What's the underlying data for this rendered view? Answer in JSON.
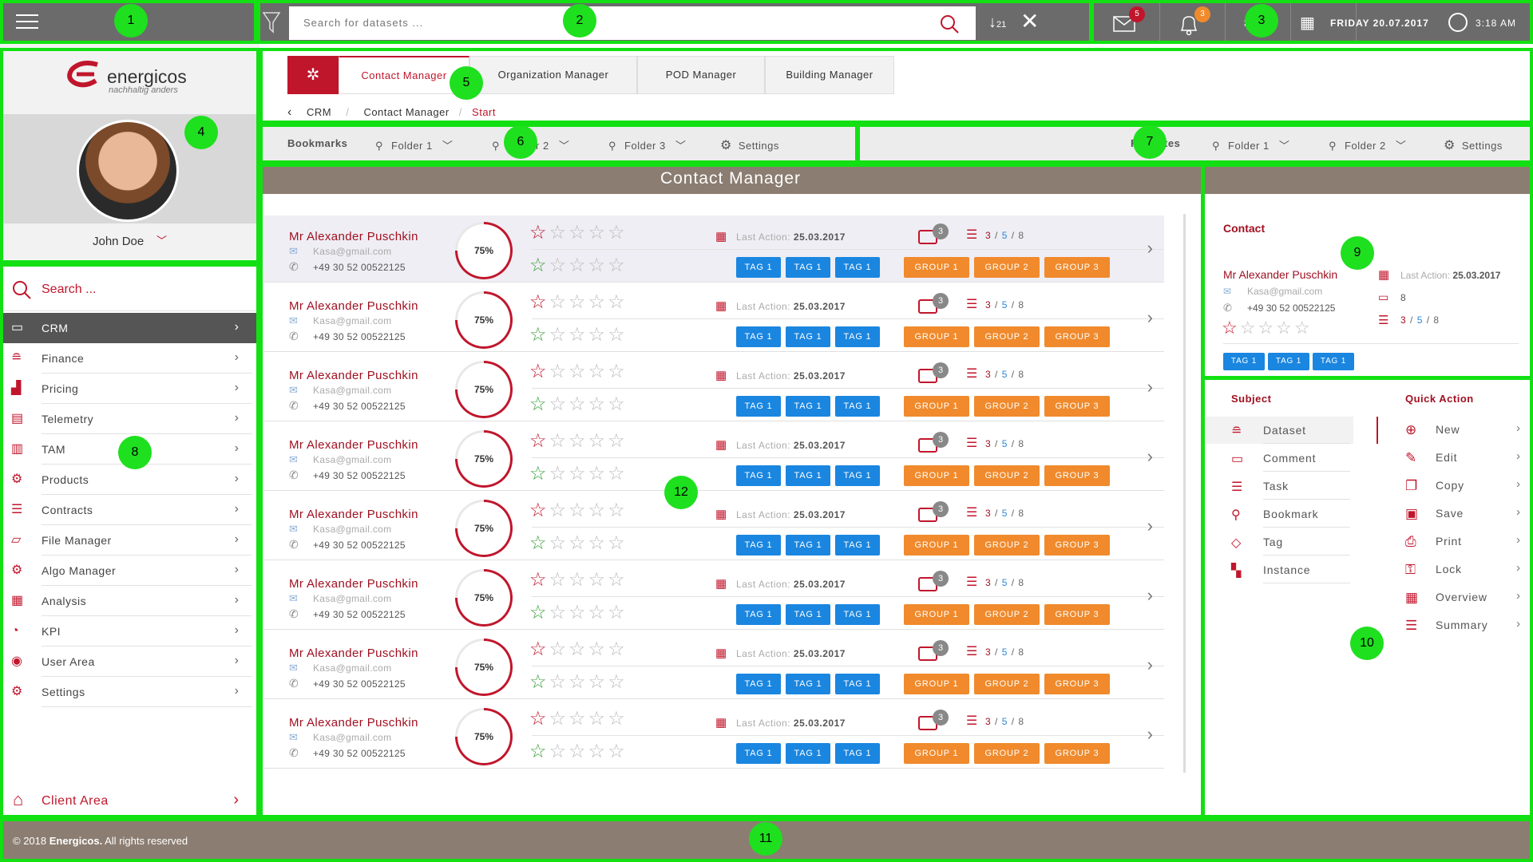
{
  "topbar": {
    "search_placeholder": "Search for datasets ...",
    "mail_count": "5",
    "notif_count": "3",
    "date": "FRIDAY 20.07.2017",
    "time": "3:18 AM"
  },
  "profile": {
    "brand": "energicos",
    "brand_tagline": "nachhaltig anders",
    "username": "John Doe"
  },
  "sidebar": {
    "search_placeholder": "Search ...",
    "items": [
      {
        "label": "CRM",
        "icon": "monitor-icon",
        "active": true
      },
      {
        "label": "Finance",
        "icon": "coins-icon"
      },
      {
        "label": "Pricing",
        "icon": "pricing-chart-icon"
      },
      {
        "label": "Telemetry",
        "icon": "telemetry-icon"
      },
      {
        "label": "TAM",
        "icon": "battery-icon"
      },
      {
        "label": "Products",
        "icon": "products-icon"
      },
      {
        "label": "Contracts",
        "icon": "contracts-icon"
      },
      {
        "label": "File Manager",
        "icon": "folder-icon"
      },
      {
        "label": "Algo Manager",
        "icon": "algo-icon"
      },
      {
        "label": "Analysis",
        "icon": "analysis-icon"
      },
      {
        "label": "KPI",
        "icon": "kpi-icon"
      },
      {
        "label": "User Area",
        "icon": "eye-icon"
      },
      {
        "label": "Settings",
        "icon": "gear-icon"
      }
    ],
    "client_area": "Client Area"
  },
  "tabs": [
    {
      "label": "Contact Manager",
      "active": true
    },
    {
      "label": "Organization Manager"
    },
    {
      "label": "POD Manager"
    },
    {
      "label": "Building Manager"
    }
  ],
  "breadcrumb": {
    "items": [
      "CRM",
      "Contact Manager"
    ],
    "current": "Start"
  },
  "bookmarks": {
    "title": "Bookmarks",
    "folders": [
      "Folder 1",
      "Folder 2",
      "Folder 3"
    ],
    "settings": "Settings"
  },
  "favorites": {
    "title": "Favorites",
    "folders": [
      "Folder 1",
      "Folder 2"
    ],
    "settings": "Settings"
  },
  "main": {
    "title": "Contact Manager",
    "rows": [
      {
        "name": "Mr Alexander Puschkin",
        "email": "Kasa@gmail.com",
        "phone": "+49 30 52 00522125",
        "progress": "75%",
        "last_action_label": "Last Action:",
        "last_action": "25.03.2017",
        "comments": "3",
        "tasks_done": "3",
        "tasks_open": "5",
        "tasks_total": "8",
        "tags": [
          "TAG 1",
          "TAG 1",
          "TAG 1"
        ],
        "groups": [
          "GROUP 1",
          "GROUP 2",
          "GROUP 3"
        ]
      },
      {
        "name": "Mr Alexander Puschkin",
        "email": "Kasa@gmail.com",
        "phone": "+49 30 52 00522125",
        "progress": "75%",
        "last_action_label": "Last Action:",
        "last_action": "25.03.2017",
        "comments": "3",
        "tasks_done": "3",
        "tasks_open": "5",
        "tasks_total": "8",
        "tags": [
          "TAG 1",
          "TAG 1",
          "TAG 1"
        ],
        "groups": [
          "GROUP 1",
          "GROUP 2",
          "GROUP 3"
        ]
      },
      {
        "name": "Mr Alexander Puschkin",
        "email": "Kasa@gmail.com",
        "phone": "+49 30 52 00522125",
        "progress": "75%",
        "last_action_label": "Last Action:",
        "last_action": "25.03.2017",
        "comments": "3",
        "tasks_done": "3",
        "tasks_open": "5",
        "tasks_total": "8",
        "tags": [
          "TAG 1",
          "TAG 1",
          "TAG 1"
        ],
        "groups": [
          "GROUP 1",
          "GROUP 2",
          "GROUP 3"
        ]
      },
      {
        "name": "Mr Alexander Puschkin",
        "email": "Kasa@gmail.com",
        "phone": "+49 30 52 00522125",
        "progress": "75%",
        "last_action_label": "Last Action:",
        "last_action": "25.03.2017",
        "comments": "3",
        "tasks_done": "3",
        "tasks_open": "5",
        "tasks_total": "8",
        "tags": [
          "TAG 1",
          "TAG 1",
          "TAG 1"
        ],
        "groups": [
          "GROUP 1",
          "GROUP 2",
          "GROUP 3"
        ]
      },
      {
        "name": "Mr Alexander Puschkin",
        "email": "Kasa@gmail.com",
        "phone": "+49 30 52 00522125",
        "progress": "75%",
        "last_action_label": "Last Action:",
        "last_action": "25.03.2017",
        "comments": "3",
        "tasks_done": "3",
        "tasks_open": "5",
        "tasks_total": "8",
        "tags": [
          "TAG 1",
          "TAG 1",
          "TAG 1"
        ],
        "groups": [
          "GROUP 1",
          "GROUP 2",
          "GROUP 3"
        ]
      },
      {
        "name": "Mr Alexander Puschkin",
        "email": "Kasa@gmail.com",
        "phone": "+49 30 52 00522125",
        "progress": "75%",
        "last_action_label": "Last Action:",
        "last_action": "25.03.2017",
        "comments": "3",
        "tasks_done": "3",
        "tasks_open": "5",
        "tasks_total": "8",
        "tags": [
          "TAG 1",
          "TAG 1",
          "TAG 1"
        ],
        "groups": [
          "GROUP 1",
          "GROUP 2",
          "GROUP 3"
        ]
      },
      {
        "name": "Mr Alexander Puschkin",
        "email": "Kasa@gmail.com",
        "phone": "+49 30 52 00522125",
        "progress": "75%",
        "last_action_label": "Last Action:",
        "last_action": "25.03.2017",
        "comments": "3",
        "tasks_done": "3",
        "tasks_open": "5",
        "tasks_total": "8",
        "tags": [
          "TAG 1",
          "TAG 1",
          "TAG 1"
        ],
        "groups": [
          "GROUP 1",
          "GROUP 2",
          "GROUP 3"
        ]
      },
      {
        "name": "Mr Alexander Puschkin",
        "email": "Kasa@gmail.com",
        "phone": "+49 30 52 00522125",
        "progress": "75%",
        "last_action_label": "Last Action:",
        "last_action": "25.03.2017",
        "comments": "3",
        "tasks_done": "3",
        "tasks_open": "5",
        "tasks_total": "8",
        "tags": [
          "TAG 1",
          "TAG 1",
          "TAG 1"
        ],
        "groups": [
          "GROUP 1",
          "GROUP 2",
          "GROUP 3"
        ]
      }
    ]
  },
  "contact_card": {
    "title": "Contact",
    "name": "Mr Alexander Puschkin",
    "email": "Kasa@gmail.com",
    "phone": "+49 30 52 00522125",
    "last_action_label": "Last Action:",
    "last_action": "25.03.2017",
    "comments": "8",
    "tasks_done": "3",
    "tasks_open": "5",
    "tasks_total": "8",
    "tags": [
      "TAG 1",
      "TAG 1",
      "TAG 1"
    ]
  },
  "subject": {
    "title": "Subject",
    "items": [
      {
        "label": "Dataset",
        "icon": "database-icon"
      },
      {
        "label": "Comment",
        "icon": "comment-icon"
      },
      {
        "label": "Task",
        "icon": "task-list-icon"
      },
      {
        "label": "Bookmark",
        "icon": "bookmark-icon"
      },
      {
        "label": "Tag",
        "icon": "tag-icon"
      },
      {
        "label": "Instance",
        "icon": "instance-icon"
      }
    ]
  },
  "quick_action": {
    "title": "Quick Action",
    "items": [
      {
        "label": "New",
        "icon": "plus-circle-icon"
      },
      {
        "label": "Edit",
        "icon": "pencil-icon"
      },
      {
        "label": "Copy",
        "icon": "copy-icon"
      },
      {
        "label": "Save",
        "icon": "save-icon"
      },
      {
        "label": "Print",
        "icon": "printer-icon"
      },
      {
        "label": "Lock",
        "icon": "lock-icon"
      },
      {
        "label": "Overview",
        "icon": "overview-icon"
      },
      {
        "label": "Summary",
        "icon": "summary-icon"
      }
    ]
  },
  "footer": {
    "copyright_prefix": "© 2018 ",
    "company": "Energicos.",
    "copyright_suffix": " All rights reserved"
  },
  "annotations": [
    "1",
    "2",
    "3",
    "4",
    "5",
    "6",
    "7",
    "8",
    "9",
    "10",
    "11",
    "12"
  ],
  "colors": {
    "accent": "#c0162c",
    "tag_blue": "#1a86e0",
    "group_orange": "#f08a2c",
    "header_brown": "#8b7d71",
    "topbar_gray": "#6b6b6b",
    "highlight_green": "#12e012"
  }
}
